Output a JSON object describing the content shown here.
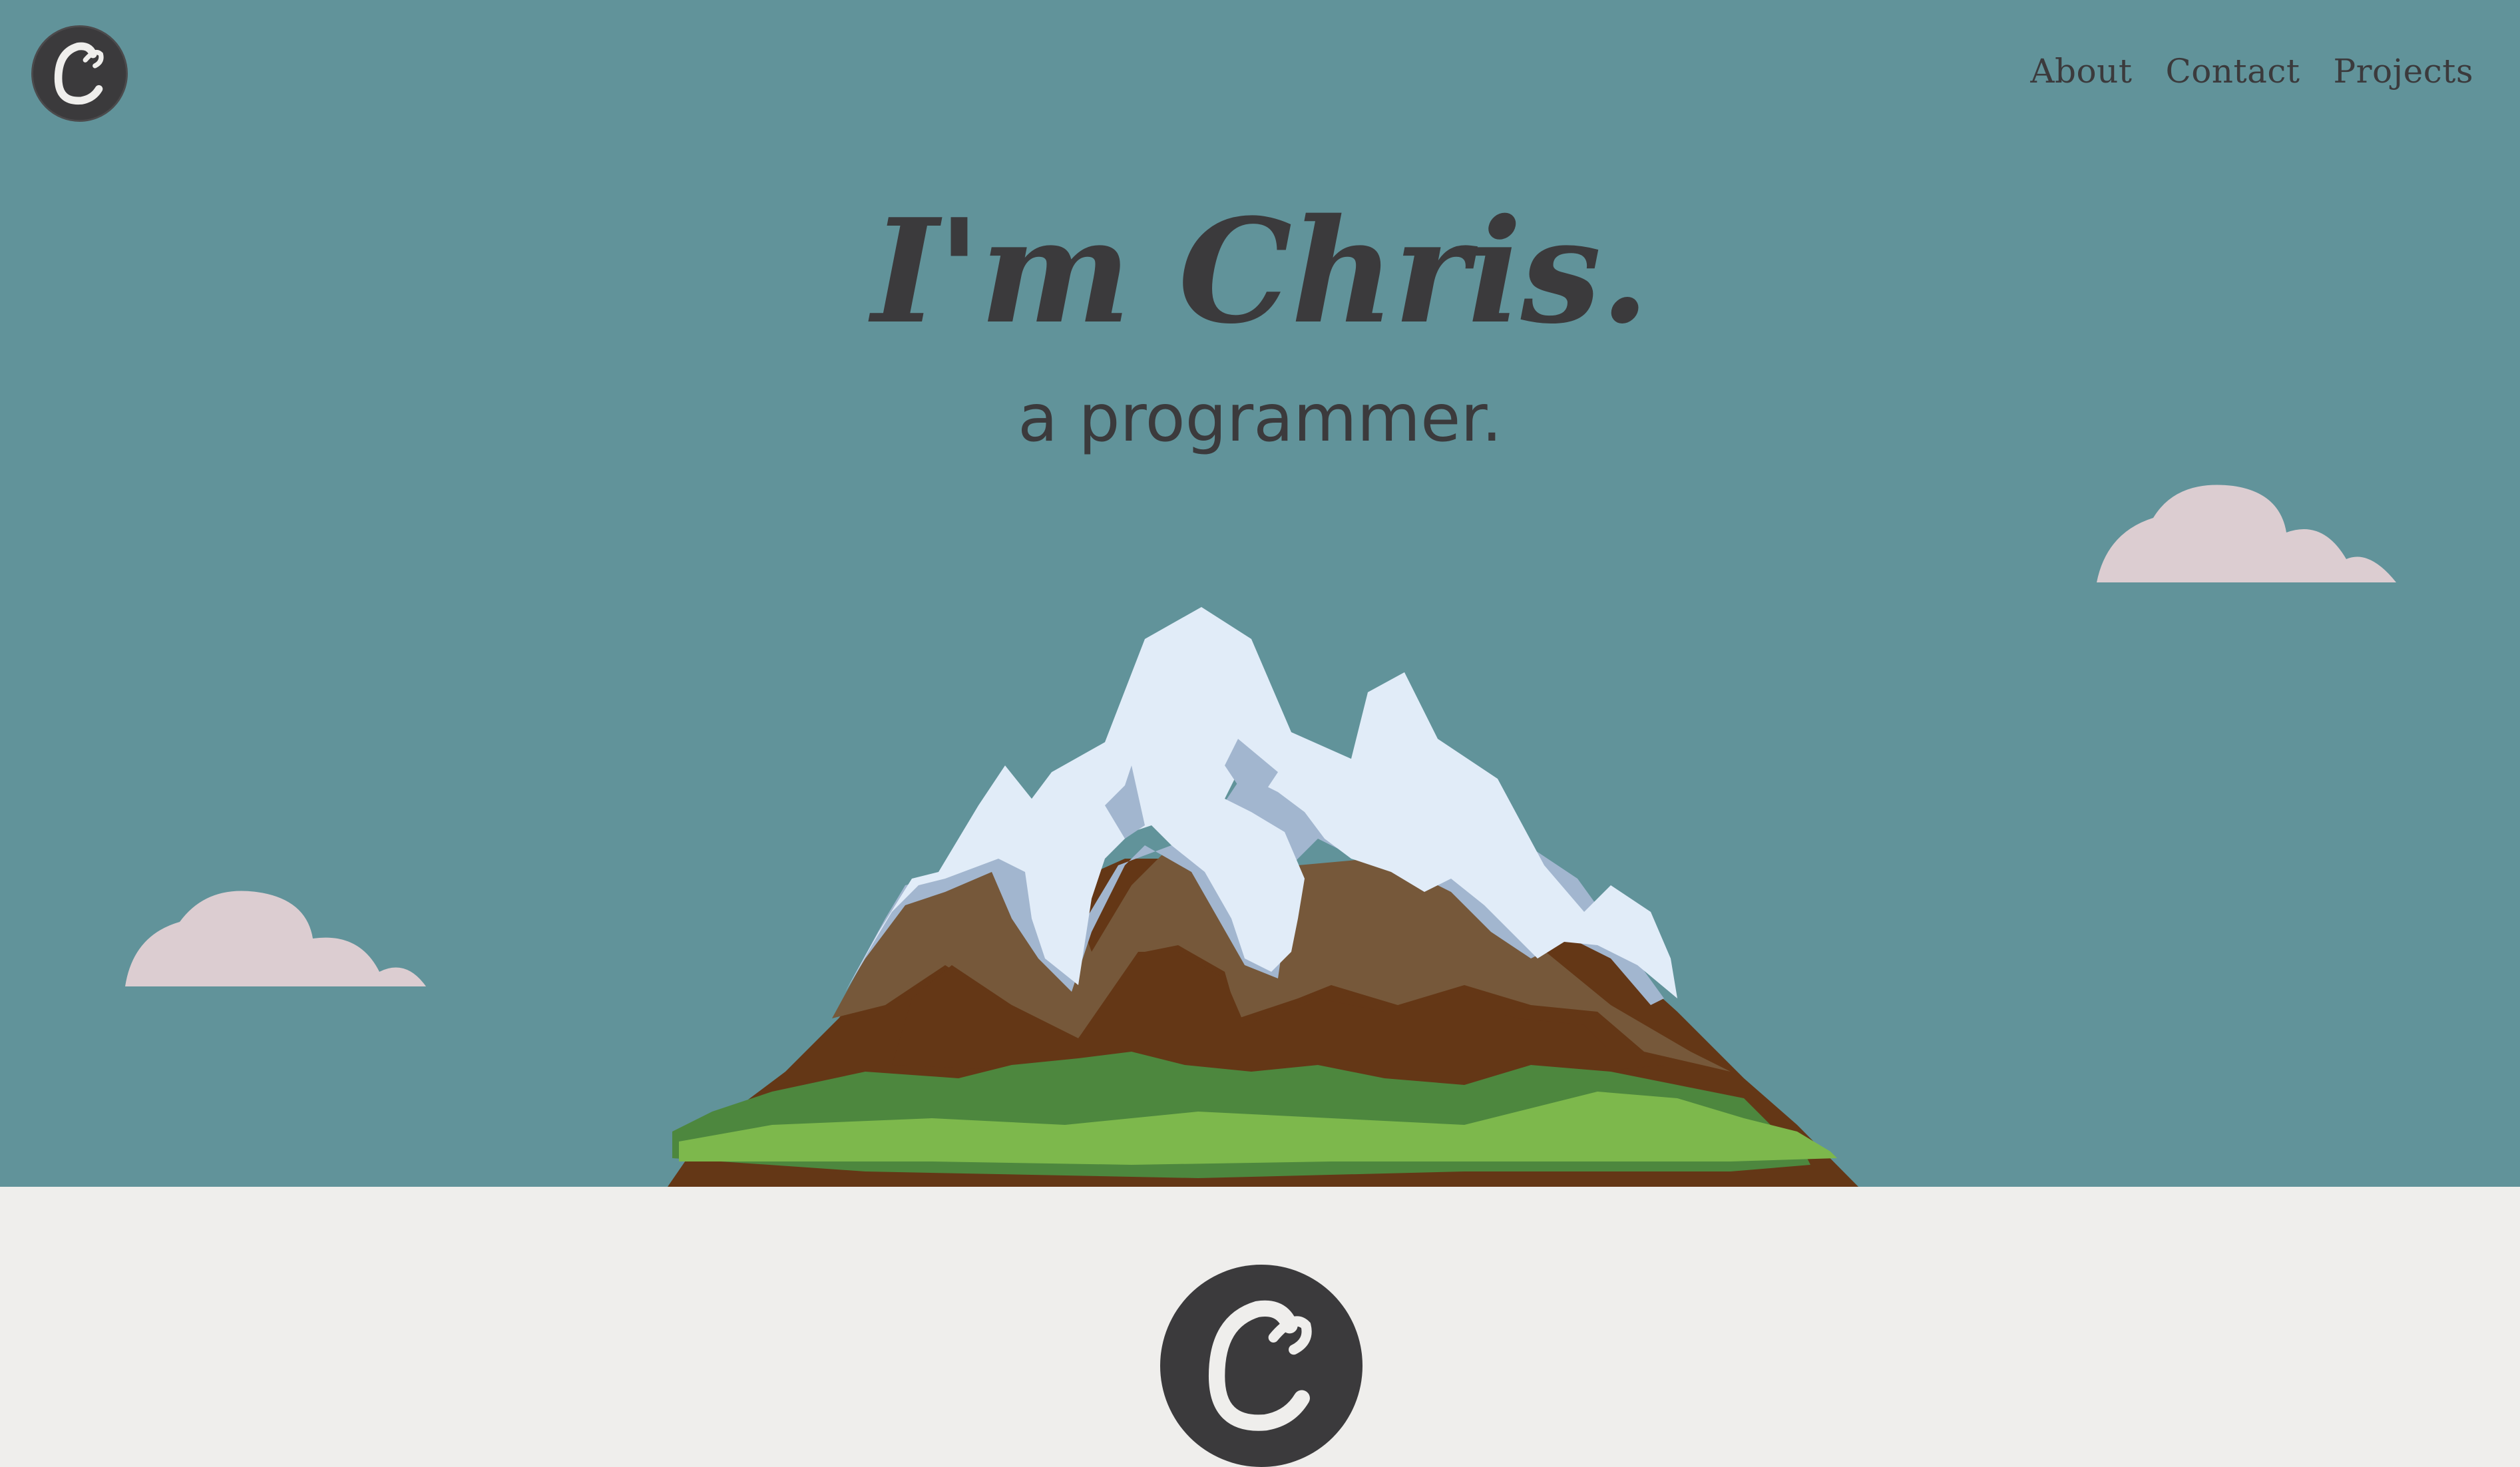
{
  "nav": {
    "items": [
      {
        "label": "About"
      },
      {
        "label": "Contact"
      },
      {
        "label": "Projects"
      }
    ]
  },
  "hero": {
    "title": "I'm Chris.",
    "subtitle": "a programmer."
  },
  "logo": {
    "letter": "C"
  },
  "colors": {
    "sky": "#61939a",
    "text": "#3b3a3c",
    "footer_bg": "#efeeec",
    "cloud": "#dccdd1",
    "snow": "#e1ecf8",
    "snow_shadow": "#a2b6cf",
    "rock_light": "#76583a",
    "rock_dark": "#643716",
    "grass_dark": "#4d873e",
    "grass_light": "#7db84c"
  }
}
